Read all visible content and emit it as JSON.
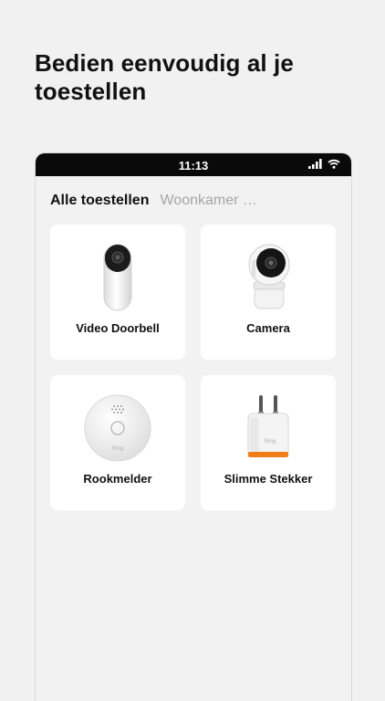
{
  "headline": "Bedien eenvoudig al je toestellen",
  "status_bar": {
    "time": "11:13"
  },
  "tabs": [
    {
      "label": "Alle toestellen",
      "active": true
    },
    {
      "label": "Woonkamer …",
      "active": false
    }
  ],
  "devices": [
    {
      "label": "Video Doorbell",
      "icon": "video-doorbell"
    },
    {
      "label": "Camera",
      "icon": "indoor-camera"
    },
    {
      "label": "Rookmelder",
      "icon": "smoke-detector"
    },
    {
      "label": "Slimme Stekker",
      "icon": "smart-plug"
    }
  ],
  "brand_mark": "Ring",
  "colors": {
    "accent": "#f07d19",
    "background": "#f1f1f1",
    "card": "#ffffff",
    "status_bar": "#0a0a0a"
  }
}
